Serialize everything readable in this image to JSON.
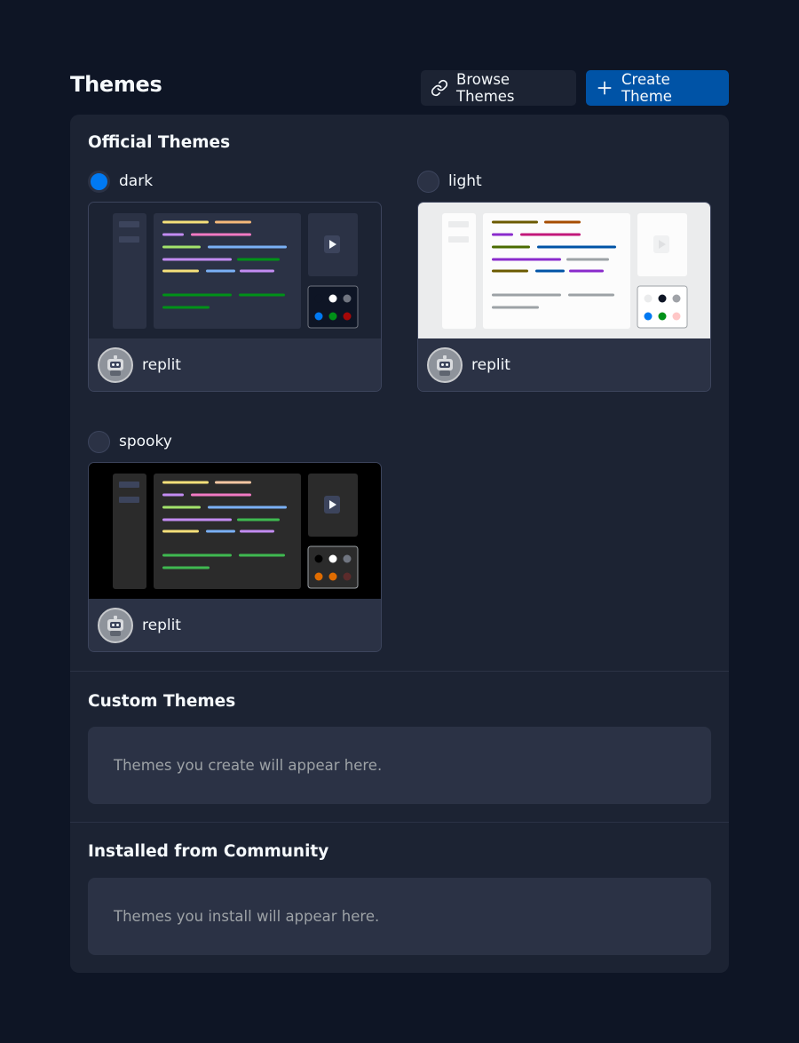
{
  "header": {
    "title": "Themes",
    "browse_label": "Browse Themes",
    "create_label": "Create Theme"
  },
  "official": {
    "title": "Official Themes",
    "themes": [
      {
        "name": "dark",
        "author": "replit",
        "selected": true,
        "colors": {
          "bg": "#1c2333",
          "sidebar": "#2b3245",
          "editor": "#2b3245",
          "panel": "#2b3245",
          "swatch_border": "#707580",
          "swatch_bg": "#0e1525",
          "swatches": [
            "#0e1525",
            "#ffffff",
            "#707580",
            "#0079f2",
            "#009118",
            "#a60808"
          ],
          "code": [
            "#f5e07a",
            "#f5b97a",
            "#c38cf2",
            "#f27ac3",
            "#a3e36b",
            "#7ab0f5",
            "#009118"
          ]
        }
      },
      {
        "name": "light",
        "author": "replit",
        "selected": false,
        "colors": {
          "bg": "#ebeced",
          "sidebar": "#fcfcfc",
          "editor": "#fcfcfc",
          "panel": "#fcfcfc",
          "swatch_border": "#9da2a6",
          "swatch_bg": "#ffffff",
          "swatches": [
            "#ebeced",
            "#0e1525",
            "#a0a3a8",
            "#0079f2",
            "#009118",
            "#ffc7c7"
          ],
          "code": [
            "#6b5a00",
            "#a64d00",
            "#8a2bcc",
            "#c2187a",
            "#4a6b00",
            "#0053a6",
            "#9da2a6"
          ]
        }
      },
      {
        "name": "spooky",
        "author": "replit",
        "selected": false,
        "colors": {
          "bg": "#000000",
          "sidebar": "#2b2b2b",
          "editor": "#2b2b2b",
          "panel": "#2b2b2b",
          "swatch_border": "#9da2a6",
          "swatch_bg": "#2b2b2b",
          "swatches": [
            "#000000",
            "#ffffff",
            "#707580",
            "#e06c00",
            "#e06c00",
            "#5c2b2b"
          ],
          "code": [
            "#f5e07a",
            "#f5c7a3",
            "#c38cf2",
            "#f27ac3",
            "#a3e36b",
            "#7ab0f5",
            "#3fb950"
          ]
        }
      }
    ]
  },
  "custom": {
    "title": "Custom Themes",
    "empty_text": "Themes you create will appear here."
  },
  "community": {
    "title": "Installed from Community",
    "empty_text": "Themes you install will appear here."
  }
}
